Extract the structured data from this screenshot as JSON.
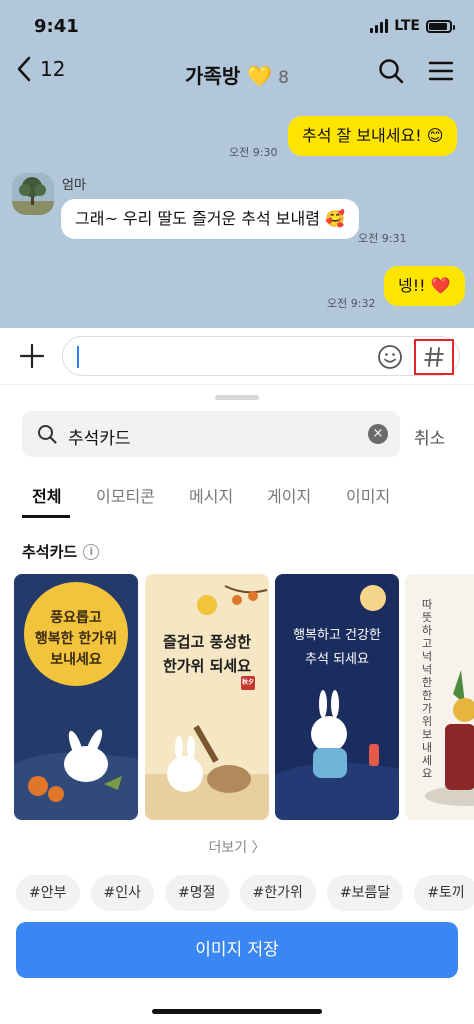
{
  "status": {
    "time": "9:41",
    "network": "LTE",
    "battery_level": 0.9
  },
  "header": {
    "back_count": "12",
    "title": "가족방 💛",
    "members": "8"
  },
  "messages": [
    {
      "from": "me",
      "text": "추석 잘 보내세요! 😊",
      "time": "오전 9:30"
    },
    {
      "from": "them",
      "sender": "엄마",
      "text": "그래~ 우리 딸도 즐거운 추석 보내렴 🥰",
      "time": "오전 9:31"
    },
    {
      "from": "me",
      "text": "넹!! ❤️",
      "time": "오전 9:32"
    }
  ],
  "composer": {
    "value": "",
    "placeholder": ""
  },
  "search": {
    "query": "추석카드",
    "clear": "×",
    "cancel_label": "취소"
  },
  "tabs": [
    "전체",
    "이모티콘",
    "메시지",
    "게이지",
    "이미지"
  ],
  "section": {
    "title": "추석카드",
    "info": "i"
  },
  "cards": [
    {
      "text": "풍요롭고\n행복한 한가위\n보내세요"
    },
    {
      "text": "즐겁고 풍성한\n한가위 되세요",
      "seal": "秋夕"
    },
    {
      "text": "행복하고 건강한\n추석 되세요"
    },
    {
      "text": "따뜻하고 넉넉한 한가위 보내세요"
    }
  ],
  "more_label": "더보기 〉",
  "chips": [
    "#안부",
    "#인사",
    "#명절",
    "#한가위",
    "#보름달",
    "#토끼"
  ],
  "save_label": "이미지 저장",
  "colors": {
    "chat_bg": "#b2c7d9",
    "my_bubble": "#fee500",
    "primary_button": "#3a86f3",
    "highlight_border": "#e0262b"
  }
}
